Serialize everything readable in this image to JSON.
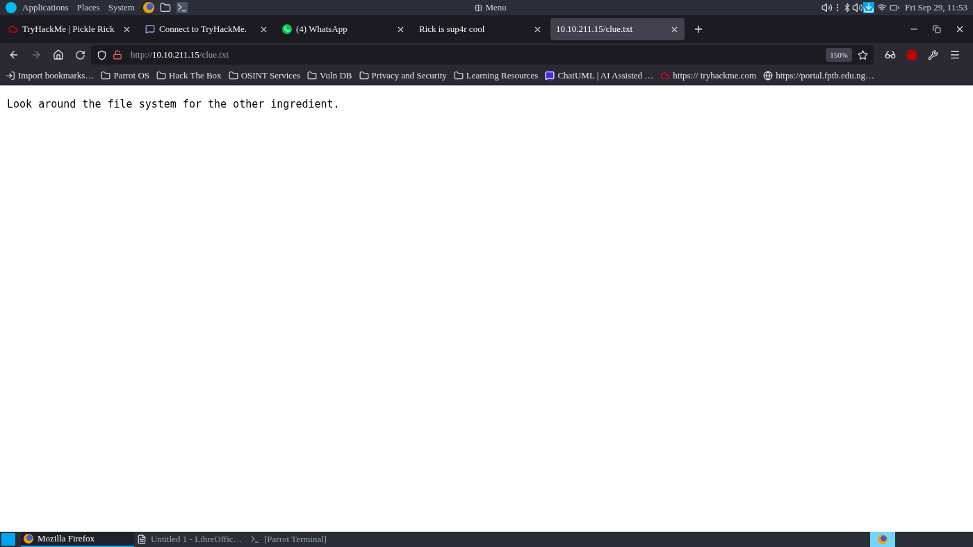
{
  "top_panel": {
    "menus": [
      "Applications",
      "Places",
      "System"
    ],
    "center_menu": "Menu",
    "clock": "Fri Sep 29, 11:53"
  },
  "tabs": [
    {
      "title": "TryHackMe | Pickle Rick",
      "kind": "cloud",
      "selected": false
    },
    {
      "title": "Connect to TryHackMe.",
      "kind": "chat",
      "selected": false
    },
    {
      "title": "(4) WhatsApp",
      "kind": "phone",
      "selected": false
    },
    {
      "title": "Rick is sup4r cool",
      "kind": "plain",
      "selected": false
    },
    {
      "title": "10.10.211.15/clue.txt",
      "kind": "plain",
      "selected": true
    }
  ],
  "address_bar": {
    "scheme": "http://",
    "host": "10.10.211.15",
    "path": "/clue.txt",
    "zoom": "150%"
  },
  "bookmarks": [
    {
      "label": "Import bookmarks…",
      "kind": "import"
    },
    {
      "label": "Parrot OS",
      "kind": "folder"
    },
    {
      "label": "Hack The Box",
      "kind": "folder"
    },
    {
      "label": "OSINT Services",
      "kind": "folder"
    },
    {
      "label": "Vuln DB",
      "kind": "folder"
    },
    {
      "label": "Privacy and Security",
      "kind": "folder"
    },
    {
      "label": "Learning Resources",
      "kind": "folder"
    },
    {
      "label": "ChatUML | AI Assisted …",
      "kind": "chat"
    },
    {
      "label": "https:// tryhackme.com",
      "kind": "cloud"
    },
    {
      "label": "https://portal.fptb.edu.ng…",
      "kind": "globe"
    }
  ],
  "page_text": "Look around the file system for the other ingredient.",
  "taskbar": [
    {
      "label": "Mozilla Firefox",
      "kind": "firefox",
      "selected": true
    },
    {
      "label": "Untitled 1 - LibreOffic…",
      "kind": "document",
      "selected": false
    },
    {
      "label": "[Parrot Terminal]",
      "kind": "terminal",
      "selected": false
    }
  ]
}
